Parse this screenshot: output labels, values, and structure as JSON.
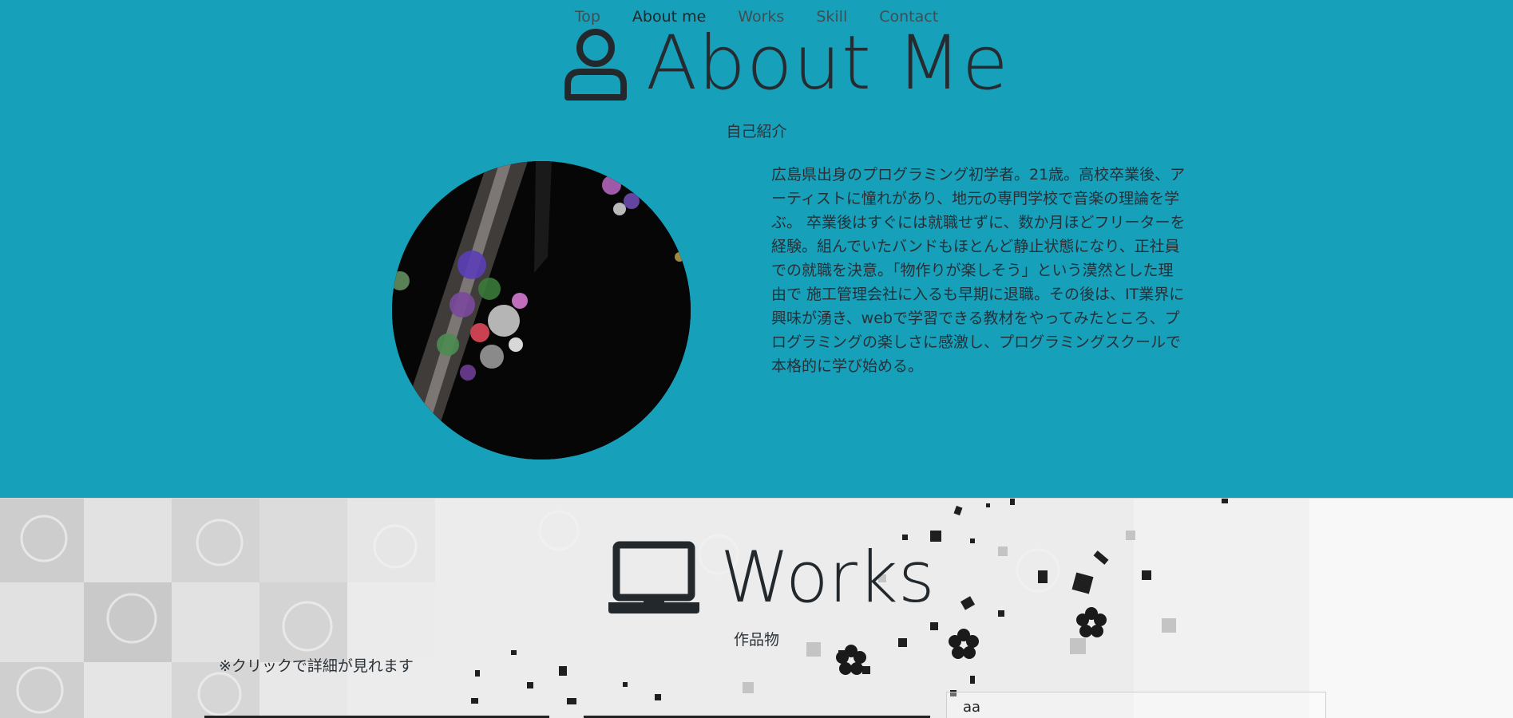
{
  "nav": {
    "items": [
      {
        "label": "Top"
      },
      {
        "label": "About me"
      },
      {
        "label": "Works"
      },
      {
        "label": "Skill"
      },
      {
        "label": "Contact"
      }
    ],
    "active": "About me"
  },
  "about": {
    "icon": "user-icon",
    "title": "About Me",
    "subtitle": "自己紹介",
    "bio_lines": [
      "広島県出身のプログラミング初学者。21歳。高校卒業後、ア",
      "ーティストに憧れがあり、地元の専門学校で音楽の理論を学",
      "ぶ。 卒業後はすぐには就職せずに、数か月ほどフリーターを",
      "経験。組んでいたバンドもほとんど静止状態になり、正社員",
      "での就職を決意。「物作りが楽しそう」という漠然とした理",
      "由で 施工管理会社に入るも早期に退職。その後は、IT業界に",
      "興味が湧き、webで学習できる教材をやってみたところ、プ",
      "ログラミングの楽しさに感激し、プログラミングスクールで",
      "本格的に学び始める。"
    ]
  },
  "works": {
    "icon": "laptop-icon",
    "title": "Works",
    "subtitle": "作品物",
    "note": "※クリックで詳細が見れます",
    "card_label": "aa"
  },
  "colors": {
    "about_bg": "#17a0b9",
    "text_dark": "#252b31"
  }
}
